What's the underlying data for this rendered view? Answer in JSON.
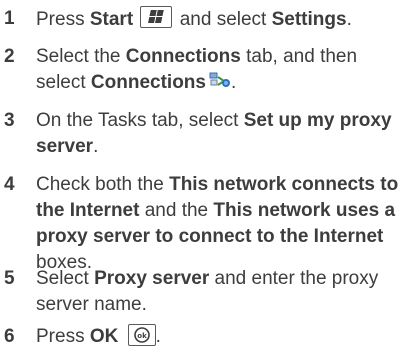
{
  "steps": [
    {
      "number": "1",
      "segments": [
        {
          "text": "Press ",
          "bold": false
        },
        {
          "text": "Start",
          "bold": true
        },
        {
          "text": " ",
          "bold": false
        },
        {
          "icon": "windows-start-key-icon"
        },
        {
          "text": " and select ",
          "bold": false
        },
        {
          "text": "Settings",
          "bold": true
        },
        {
          "text": ".",
          "bold": false
        }
      ]
    },
    {
      "number": "2",
      "segments": [
        {
          "text": "Select the ",
          "bold": false
        },
        {
          "text": "Connections",
          "bold": true
        },
        {
          "text": " tab, and then select ",
          "bold": false
        },
        {
          "text": "Connections",
          "bold": true
        },
        {
          "icon": "connections-icon"
        },
        {
          "text": ".",
          "bold": false
        }
      ]
    },
    {
      "number": "3",
      "segments": [
        {
          "text": "On the Tasks tab, select ",
          "bold": false
        },
        {
          "text": "Set up my proxy server",
          "bold": true
        },
        {
          "text": ".",
          "bold": false
        }
      ]
    },
    {
      "number": "4",
      "segments": [
        {
          "text": "Check both the ",
          "bold": false
        },
        {
          "text": "This network connects to the Internet",
          "bold": true
        },
        {
          "text": " and the ",
          "bold": false
        },
        {
          "text": "This network uses a proxy server to connect to the Internet",
          "bold": true
        },
        {
          "text": " boxes.",
          "bold": false
        }
      ]
    },
    {
      "number": "5",
      "segments": [
        {
          "text": "Select ",
          "bold": false
        },
        {
          "text": "Proxy server",
          "bold": true
        },
        {
          "text": " and enter the proxy server name.",
          "bold": false
        }
      ]
    },
    {
      "number": "6",
      "segments": [
        {
          "text": "Press ",
          "bold": false
        },
        {
          "text": "OK",
          "bold": true
        },
        {
          "text": " ",
          "bold": false
        },
        {
          "icon": "ok-key-icon"
        },
        {
          "text": ".",
          "bold": false
        }
      ]
    }
  ],
  "colors": {
    "text": "#3d3d3d",
    "icon_border": "#5a5a5a",
    "connections_blue": "#2f6fbf",
    "connections_green": "#3a9a3a"
  }
}
